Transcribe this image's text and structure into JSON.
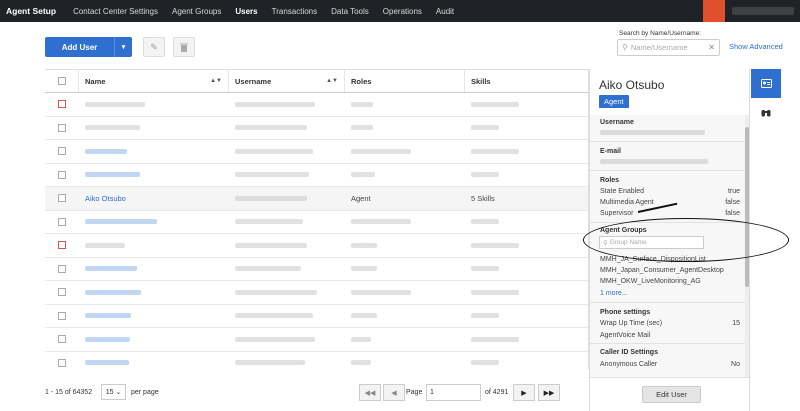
{
  "topbar": {
    "brand": "Agent Setup",
    "nav": [
      "Contact Center Settings",
      "Agent Groups",
      "Users",
      "Transactions",
      "Data Tools",
      "Operations",
      "Audit"
    ],
    "active_index": 2,
    "accent": "#e0502c"
  },
  "toolbar": {
    "add_user_label": "Add User",
    "edit_icon": "pencil-icon",
    "delete_icon": "trash-icon"
  },
  "search": {
    "label": "Search by Name/Username:",
    "placeholder": "Name/Username",
    "show_advanced": "Show Advanced"
  },
  "table": {
    "headers": [
      "Name",
      "Username",
      "Roles",
      "Skills"
    ],
    "rows": [
      {
        "name": "",
        "username": "",
        "role": "",
        "skills": "",
        "blurred": true,
        "link": false,
        "red_check": true
      },
      {
        "name": "",
        "username": "",
        "role": "",
        "skills": "",
        "blurred": true,
        "link": false
      },
      {
        "name": "",
        "username": "",
        "role": "",
        "skills": "",
        "blurred": true,
        "link": true
      },
      {
        "name": "",
        "username": "",
        "role": "",
        "skills": "",
        "blurred": true,
        "link": true
      },
      {
        "name": "Aiko Otsubo",
        "username": "",
        "role": "Agent",
        "skills": "5 Skills",
        "blurred": false,
        "link": true,
        "selected": true
      },
      {
        "name": "",
        "username": "",
        "role": "",
        "skills": "",
        "blurred": true,
        "link": true
      },
      {
        "name": "",
        "username": "",
        "role": "",
        "skills": "",
        "blurred": true,
        "link": false,
        "red_check": true
      },
      {
        "name": "",
        "username": "",
        "role": "",
        "skills": "",
        "blurred": true,
        "link": true
      },
      {
        "name": "",
        "username": "",
        "role": "",
        "skills": "",
        "blurred": true,
        "link": true
      },
      {
        "name": "",
        "username": "",
        "role": "",
        "skills": "",
        "blurred": true,
        "link": true
      },
      {
        "name": "",
        "username": "",
        "role": "",
        "skills": "",
        "blurred": true,
        "link": true
      },
      {
        "name": "",
        "username": "",
        "role": "",
        "skills": "",
        "blurred": true,
        "link": true
      },
      {
        "name": "",
        "username": "",
        "role": "",
        "skills": "",
        "blurred": true,
        "link": true
      }
    ]
  },
  "pagination": {
    "count_text": "1 - 15 of 64352",
    "per_page": "15",
    "per_page_label": "per page",
    "page_label": "Page",
    "page_value": "1",
    "of_text": "of 4291"
  },
  "panel": {
    "name": "Aiko Otsubo",
    "badge": "Agent",
    "username_label": "Username",
    "email_label": "E-mail",
    "roles_label": "Roles",
    "roles": [
      {
        "k": "State Enabled",
        "v": "true"
      },
      {
        "k": "Multimedia Agent",
        "v": "false"
      },
      {
        "k": "Supervisor",
        "v": "false"
      }
    ],
    "agent_groups_label": "Agent Groups",
    "group_search_placeholder": "Group Name",
    "groups": [
      "MMH_JA_Surface_DispositionList",
      "MMH_Japan_Consumer_AgentDesktop",
      "MMH_OKW_LiveMonitoring_AG"
    ],
    "more": "1 more...",
    "phone_label": "Phone settings",
    "phone": [
      {
        "k": "Wrap Up Time (sec)",
        "v": "15"
      },
      {
        "k": "AgentVoice Mail",
        "v": ""
      }
    ],
    "callerid_label": "Caller ID Settings",
    "callerid": [
      {
        "k": "Anonymous Caller",
        "v": "No"
      }
    ],
    "edit_button": "Edit User"
  }
}
